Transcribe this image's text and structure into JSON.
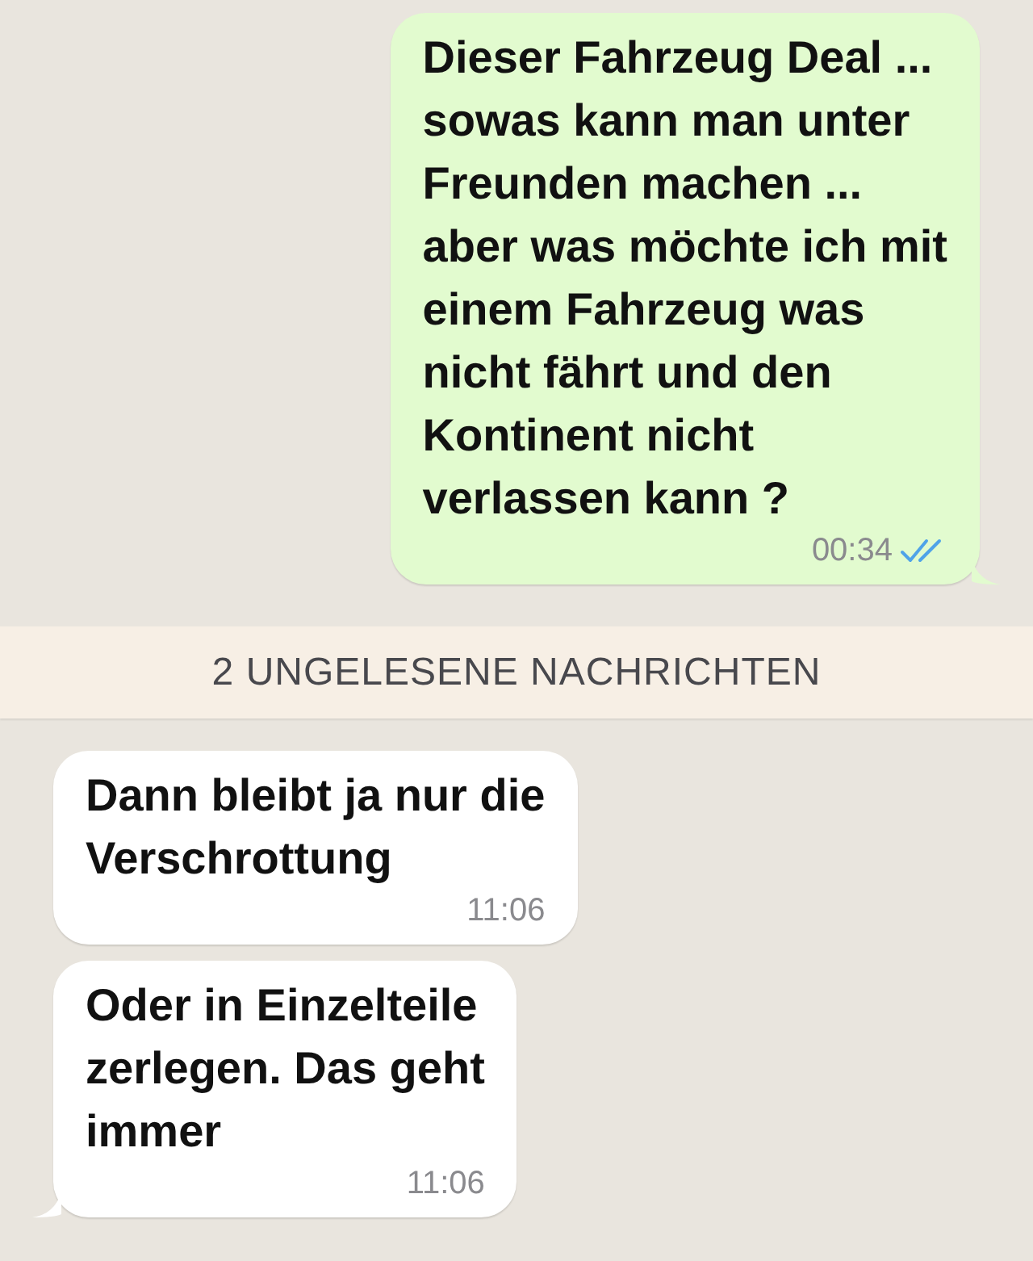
{
  "messages": [
    {
      "kind": "outgoing",
      "text": "Dieser Fahrzeug Deal ...\nsowas kann man unter\nFreunden machen ...\naber was möchte ich mit\neinem Fahrzeug was\nnicht fährt und den\nKontinent nicht\nverlassen kann ?",
      "time": "00:34",
      "read": true,
      "tail": true
    },
    {
      "kind": "divider",
      "text": "2 UNGELESENE NACHRICHTEN"
    },
    {
      "kind": "incoming",
      "text": "Dann bleibt ja nur die\nVerschrottung",
      "time": "11:06",
      "tail": false
    },
    {
      "kind": "incoming",
      "text": "Oder in Einzelteile\nzerlegen. Das geht\nimmer",
      "time": "11:06",
      "tail": true
    }
  ]
}
